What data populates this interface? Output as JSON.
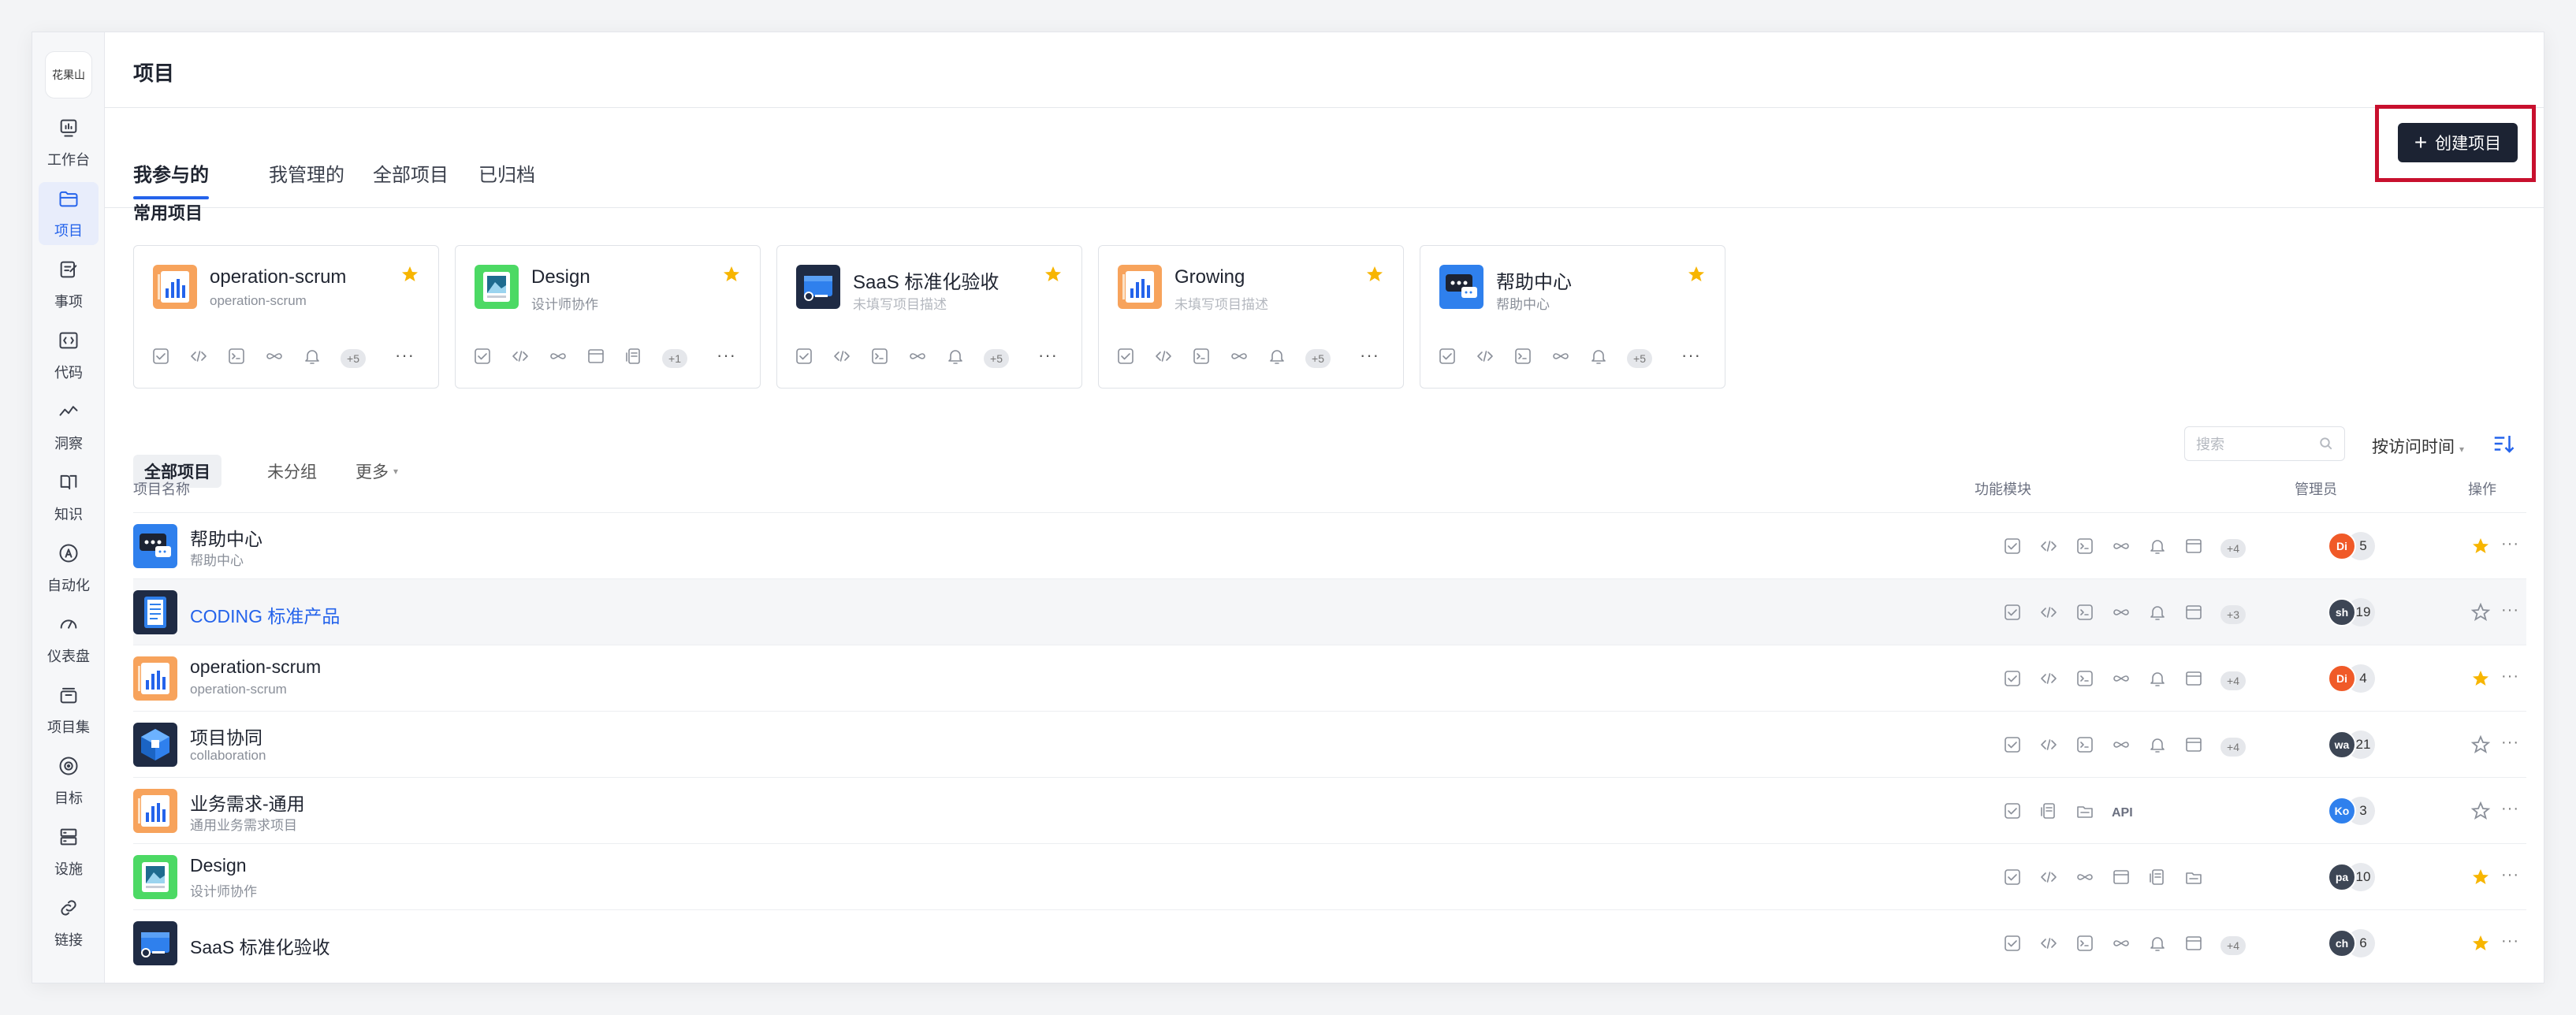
{
  "app": {
    "logo_text": "花果山",
    "page_title": "项目"
  },
  "colors": {
    "accent": "#2463eb",
    "star": "#f7b500",
    "highlight_box": "#c8102e",
    "create_btn_bg": "#1c2333"
  },
  "sidebar": {
    "items": [
      {
        "label": "工作台",
        "icon": "dashboard-icon"
      },
      {
        "label": "项目",
        "icon": "folder-icon",
        "active": true
      },
      {
        "label": "事项",
        "icon": "edit-icon"
      },
      {
        "label": "代码",
        "icon": "code-icon"
      },
      {
        "label": "洞察",
        "icon": "insight-icon"
      },
      {
        "label": "知识",
        "icon": "book-icon"
      },
      {
        "label": "自动化",
        "icon": "automation-icon"
      },
      {
        "label": "仪表盘",
        "icon": "gauge-icon"
      },
      {
        "label": "项目集",
        "icon": "stack-icon"
      },
      {
        "label": "目标",
        "icon": "target-icon"
      },
      {
        "label": "设施",
        "icon": "server-icon"
      },
      {
        "label": "链接",
        "icon": "link-icon"
      }
    ]
  },
  "tabs": [
    {
      "label": "我参与的",
      "active": true
    },
    {
      "label": "我管理的"
    },
    {
      "label": "全部项目"
    },
    {
      "label": "已归档"
    }
  ],
  "create_button": {
    "label": "创建项目"
  },
  "common": {
    "title": "常用项目",
    "cards": [
      {
        "name": "operation-scrum",
        "desc": "operation-scrum",
        "icon": "chart-project-icon",
        "badge": "+5",
        "more": "···",
        "modules": [
          "task-icon",
          "code-icon",
          "terminal-icon",
          "infinity-icon",
          "bell-icon"
        ]
      },
      {
        "name": "Design",
        "desc": "设计师协作",
        "icon": "design-project-icon",
        "badge": "+1",
        "more": "···",
        "modules": [
          "task-icon",
          "code-icon",
          "infinity-icon",
          "window-icon",
          "doc-icon"
        ]
      },
      {
        "name": "SaaS 标准化验收",
        "desc": "未填写项目描述",
        "icon": "saas-project-icon",
        "badge": "+5",
        "more": "···",
        "modules": [
          "task-icon",
          "code-icon",
          "terminal-icon",
          "infinity-icon",
          "bell-icon"
        ]
      },
      {
        "name": "Growing",
        "desc": "未填写项目描述",
        "icon": "chart-project-icon",
        "badge": "+5",
        "more": "···",
        "modules": [
          "task-icon",
          "code-icon",
          "terminal-icon",
          "infinity-icon",
          "bell-icon"
        ]
      },
      {
        "name": "帮助中心",
        "desc": "帮助中心",
        "icon": "chat-project-icon",
        "badge": "+5",
        "more": "···",
        "modules": [
          "task-icon",
          "code-icon",
          "terminal-icon",
          "infinity-icon",
          "bell-icon"
        ]
      }
    ]
  },
  "list": {
    "filters": [
      "全部项目",
      "未分组",
      "更多"
    ],
    "search_placeholder": "搜索",
    "sort_label": "按访问时间",
    "columns": {
      "name": "项目名称",
      "modules": "功能模块",
      "admin": "管理员",
      "actions": "操作"
    },
    "rows": [
      {
        "name": "帮助中心",
        "desc": "帮助中心",
        "icon": "chat-project-icon",
        "modules": [
          "task-icon",
          "code-icon",
          "terminal-icon",
          "infinity-icon",
          "bell-icon",
          "window-icon"
        ],
        "badge": "+4",
        "admin_initials": "Di",
        "admin_color": "#f05a28",
        "admin_count": "5",
        "starred": true,
        "more": "···"
      },
      {
        "name": "CODING 标准产品",
        "desc": "",
        "icon": "notebook-project-icon",
        "modules": [
          "task-icon",
          "code-icon",
          "terminal-icon",
          "infinity-icon",
          "bell-icon",
          "window-icon"
        ],
        "badge": "+3",
        "admin_initials": "sh",
        "admin_color": "#3d4655",
        "admin_count": "19",
        "starred": false,
        "more": "···"
      },
      {
        "name": "operation-scrum",
        "desc": "operation-scrum",
        "icon": "chart-project-icon",
        "modules": [
          "task-icon",
          "code-icon",
          "terminal-icon",
          "infinity-icon",
          "bell-icon",
          "window-icon"
        ],
        "badge": "+4",
        "admin_initials": "Di",
        "admin_color": "#f05a28",
        "admin_count": "4",
        "starred": true,
        "more": "···"
      },
      {
        "name": "项目协同",
        "desc": "collaboration",
        "icon": "cube-project-icon",
        "modules": [
          "task-icon",
          "code-icon",
          "terminal-icon",
          "infinity-icon",
          "bell-icon",
          "window-icon"
        ],
        "badge": "+4",
        "admin_initials": "wa",
        "admin_color": "#3d4655",
        "admin_count": "21",
        "starred": false,
        "more": "···"
      },
      {
        "name": "业务需求-通用",
        "desc": "通用业务需求项目",
        "icon": "chart-project-icon",
        "modules": [
          "task-icon",
          "doc-icon",
          "archive-icon"
        ],
        "api": "API",
        "admin_initials": "Ko",
        "admin_color": "#2f80ed",
        "admin_count": "3",
        "starred": false,
        "more": "···"
      },
      {
        "name": "Design",
        "desc": "设计师协作",
        "icon": "design-project-icon",
        "modules": [
          "task-icon",
          "code-icon",
          "infinity-icon",
          "window-icon",
          "doc-icon",
          "archive-icon"
        ],
        "admin_initials": "pa",
        "admin_color": "#3d4655",
        "admin_count": "10",
        "starred": true,
        "more": "···"
      },
      {
        "name": "SaaS 标准化验收",
        "desc": "",
        "icon": "saas-project-icon",
        "modules": [
          "task-icon",
          "code-icon",
          "terminal-icon",
          "infinity-icon",
          "bell-icon",
          "window-icon"
        ],
        "badge": "+4",
        "admin_initials": "ch",
        "admin_color": "#3d4655",
        "admin_count": "6",
        "starred": true,
        "more": "···"
      }
    ]
  }
}
